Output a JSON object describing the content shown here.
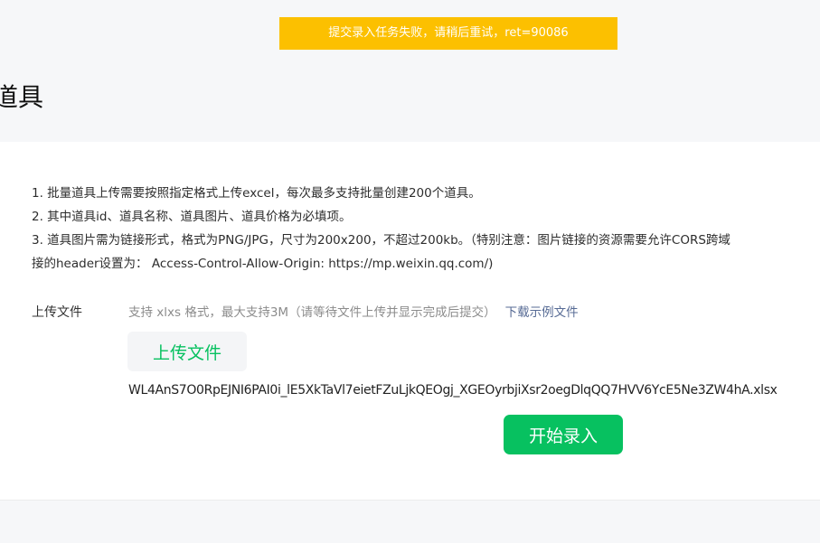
{
  "toast": {
    "message": "提交录入任务失败，请稍后重试，ret=90086"
  },
  "page": {
    "title": "道具"
  },
  "instructions": {
    "line1": "1. 批量道具上传需要按照指定格式上传excel，每次最多支持批量创建200个道具。",
    "line2": "2. 其中道具id、道具名称、道具图片、道具价格为必填项。",
    "line3": "3. 道具图片需为链接形式，格式为PNG/JPG，尺寸为200x200，不超过200kb。（特别注意：图片链接的资源需要允许CORS跨域",
    "line4": "接的header设置为： Access-Control-Allow-Origin: https://mp.weixin.qq.com/)"
  },
  "upload": {
    "label": "上传文件",
    "hint": "支持 xlxs 格式，最大支持3M（请等待文件上传并显示完成后提交）",
    "download_link": "下载示例文件",
    "button_label": "上传文件",
    "filename": "WL4AnS7O0RpEJNI6PAI0i_lE5XkTaVl7eietFZuLjkQEOgj_XGEOyrbjiXsr2oegDlqQQ7HVV6YcE5Ne3ZW4hA.xlsx"
  },
  "actions": {
    "start_label": "开始录入"
  },
  "colors": {
    "toast_bg": "#fcc000",
    "primary": "#07c160",
    "link": "#576b95",
    "page_bg": "#f6f7f9"
  }
}
